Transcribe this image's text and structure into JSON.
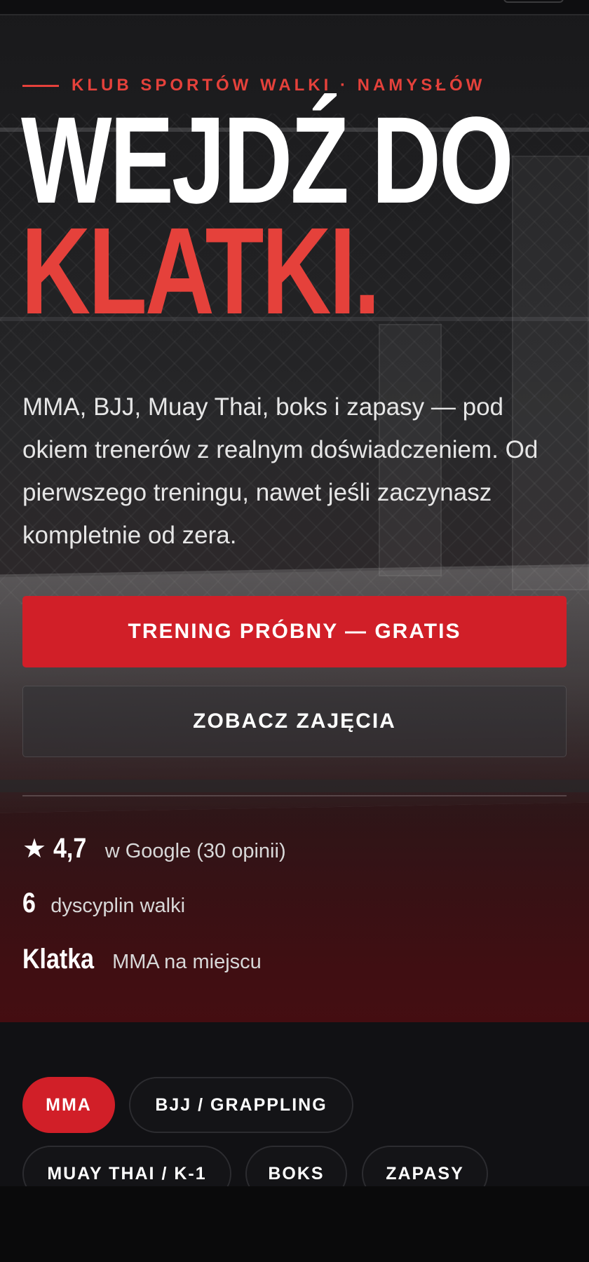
{
  "hero": {
    "eyebrow": "KLUB SPORTÓW WALKI · NAMYSŁÓW",
    "headline_line1": "WEJDŹ DO",
    "headline_line2": "KLATKI.",
    "lead": "MMA, BJJ, Muay Thai, boks i zapasy — pod okiem trenerów z realnym doświadczeniem. Od pierwszego treningu, nawet jeśli zaczynasz kompletnie od zera.",
    "primary_button": "TRENING PRÓBNY — GRATIS",
    "secondary_button": "ZOBACZ ZAJĘCIA"
  },
  "stats": [
    {
      "icon": "star-icon",
      "big": "4,7",
      "desc": "w Google (30 opinii)"
    },
    {
      "big": "6",
      "desc": "dyscyplin walki"
    },
    {
      "big": "Klatka",
      "desc": "MMA na miejscu"
    }
  ],
  "disciplines": [
    {
      "label": "MMA",
      "active": true
    },
    {
      "label": "BJJ / GRAPPLING",
      "active": false
    },
    {
      "label": "MUAY THAI / K-1",
      "active": false
    },
    {
      "label": "BOKS",
      "active": false
    },
    {
      "label": "ZAPASY",
      "active": false
    }
  ],
  "colors": {
    "accent": "#e5413b",
    "button_red": "#d11f28",
    "background": "#0c0c0e"
  }
}
